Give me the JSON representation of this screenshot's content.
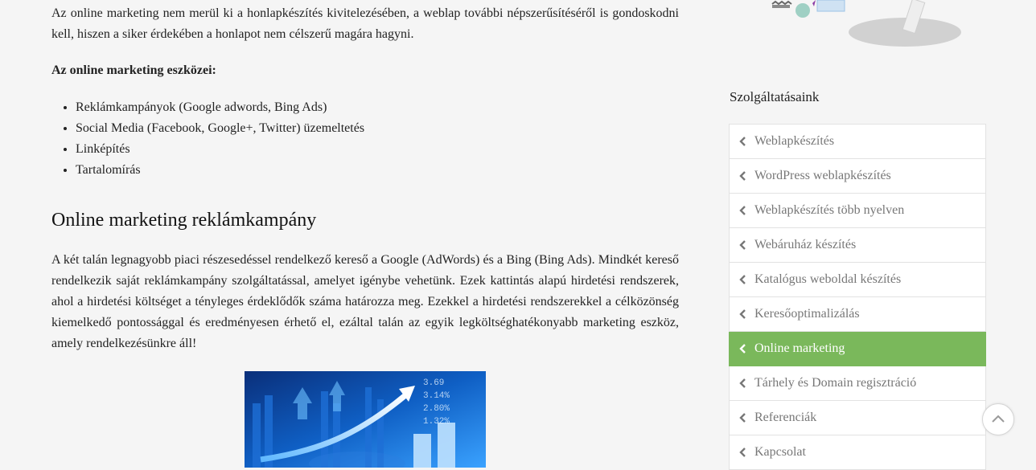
{
  "article": {
    "intro": "Az online marketing nem merül ki a honlapkészítés kivitelezésében, a weblap további népszerűsítéséről is gondoskodni kell, hiszen a siker érdekében a honlapot nem célszerű magára hagyni.",
    "tools_heading": "Az online marketing eszközei:",
    "tools": [
      "Reklámkampányok (Google adwords, Bing Ads)",
      "Social Media (Facebook, Google+, Twitter) üzemeltetés",
      "Linképítés",
      "Tartalomírás"
    ],
    "section_heading": "Online marketing reklámkampány",
    "section_paragraph": "A két talán legnagyobb piaci részesedéssel rendelkező kereső a Google (AdWords) és a Bing (Bing Ads). Mindkét kereső rendelkezik saját reklámkampány szolgáltatással, amelyet igénybe vehetünk. Ezek kattintás alapú hirdetési rendszerek, ahol a hirdetési költséget a tényleges érdeklődők száma határozza meg. Ezekkel a hirdetési rendszerekkel a célközönség kiemelkedő pontossággal és eredményesen érhető el, ezáltal talán az egyik legköltséghatékonyabb marketing eszköz, amely rendelkezésünkre áll!",
    "figure_numbers": [
      "3.69",
      "3.14%",
      "2.80%",
      "1.32%"
    ]
  },
  "sidebar": {
    "title": "Szolgáltatásaink",
    "items": [
      {
        "label": "Weblapkészítés",
        "active": false
      },
      {
        "label": "WordPress weblapkészítés",
        "active": false
      },
      {
        "label": "Weblapkészítés több nyelven",
        "active": false
      },
      {
        "label": "Webáruház készítés",
        "active": false
      },
      {
        "label": "Katalógus weboldal készítés",
        "active": false
      },
      {
        "label": "Keresőoptimalizálás",
        "active": false
      },
      {
        "label": "Online marketing",
        "active": true
      },
      {
        "label": "Tárhely és Domain regisztráció",
        "active": false
      },
      {
        "label": "Referenciák",
        "active": false
      },
      {
        "label": "Kapcsolat",
        "active": false
      }
    ]
  },
  "colors": {
    "active_item_bg": "#7ab85b",
    "page_bg": "#f5f5f5"
  },
  "icons": {
    "list_chevron": "chevron-left-icon",
    "back_to_top": "chevron-up-icon"
  }
}
